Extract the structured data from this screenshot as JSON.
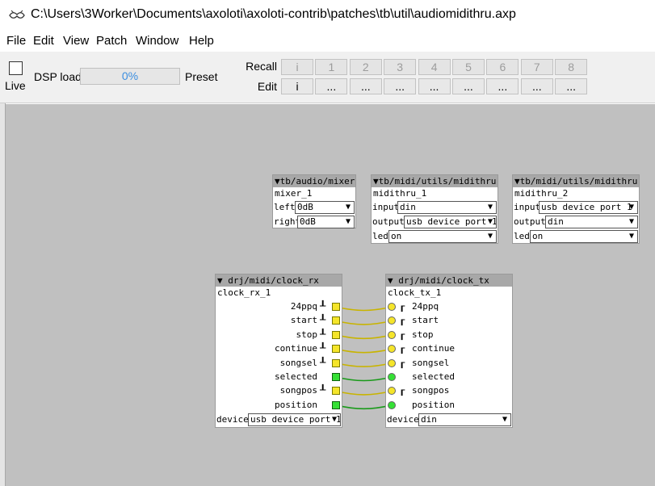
{
  "window": {
    "title": "C:\\Users\\3Worker\\Documents\\axoloti\\axoloti-contrib\\patches\\tb\\util\\audiomidithru.axp"
  },
  "menu": [
    "File",
    "Edit",
    "View",
    "Patch",
    "Window",
    "Help"
  ],
  "toolbar": {
    "live_label": "Live",
    "live_checked": false,
    "dsp_label": "DSP load",
    "dsp_value": "0%",
    "dsp_fraction": 0,
    "preset_label": "Preset",
    "recall_label": "Recall",
    "edit_label": "Edit",
    "recall_buttons": [
      "i",
      "1",
      "2",
      "3",
      "4",
      "5",
      "6",
      "7",
      "8"
    ],
    "edit_buttons": [
      "i",
      "...",
      "...",
      "...",
      "...",
      "...",
      "...",
      "...",
      "..."
    ]
  },
  "objects": {
    "mixer": {
      "type": "▼tb/audio/mixer",
      "instance": "mixer_1",
      "params": [
        {
          "label": "left",
          "value": "0dB"
        },
        {
          "label": "right",
          "value": "0dB"
        }
      ]
    },
    "midithru1": {
      "type": "▼tb/midi/utils/midithru",
      "instance": "midithru_1",
      "params": [
        {
          "label": "input",
          "value": "din"
        },
        {
          "label": "output",
          "value": "usb device port 1"
        },
        {
          "label": "led",
          "value": "on"
        }
      ]
    },
    "midithru2": {
      "type": "▼tb/midi/utils/midithru",
      "instance": "midithru_2",
      "params": [
        {
          "label": "input",
          "value": "usb device port 1"
        },
        {
          "label": "output",
          "value": "din"
        },
        {
          "label": "led",
          "value": "on"
        }
      ]
    },
    "clock_rx": {
      "type": "▼ drj/midi/clock_rx",
      "instance": "clock_rx_1",
      "outlets": [
        "24ppq",
        "start",
        "stop",
        "continue",
        "songsel",
        "selected",
        "songpos",
        "position"
      ],
      "device_label": "device",
      "device_value": "usb device port 1"
    },
    "clock_tx": {
      "type": "▼ drj/midi/clock_tx",
      "instance": "clock_tx_1",
      "inlets": [
        "24ppq",
        "start",
        "stop",
        "continue",
        "songsel",
        "selected",
        "songpos",
        "position"
      ],
      "device_label": "device",
      "device_value": "din"
    }
  },
  "colors": {
    "canvas": "#c0c0c0",
    "object_header": "#a8a8a8",
    "bool_wire": "#c8b400",
    "frac_wire": "#1a9a1a",
    "dsp_accent": "#3b8ee0"
  },
  "icons": {
    "app": "axoloti-logo-icon",
    "dropdown": "dropdown-arrow-icon"
  }
}
